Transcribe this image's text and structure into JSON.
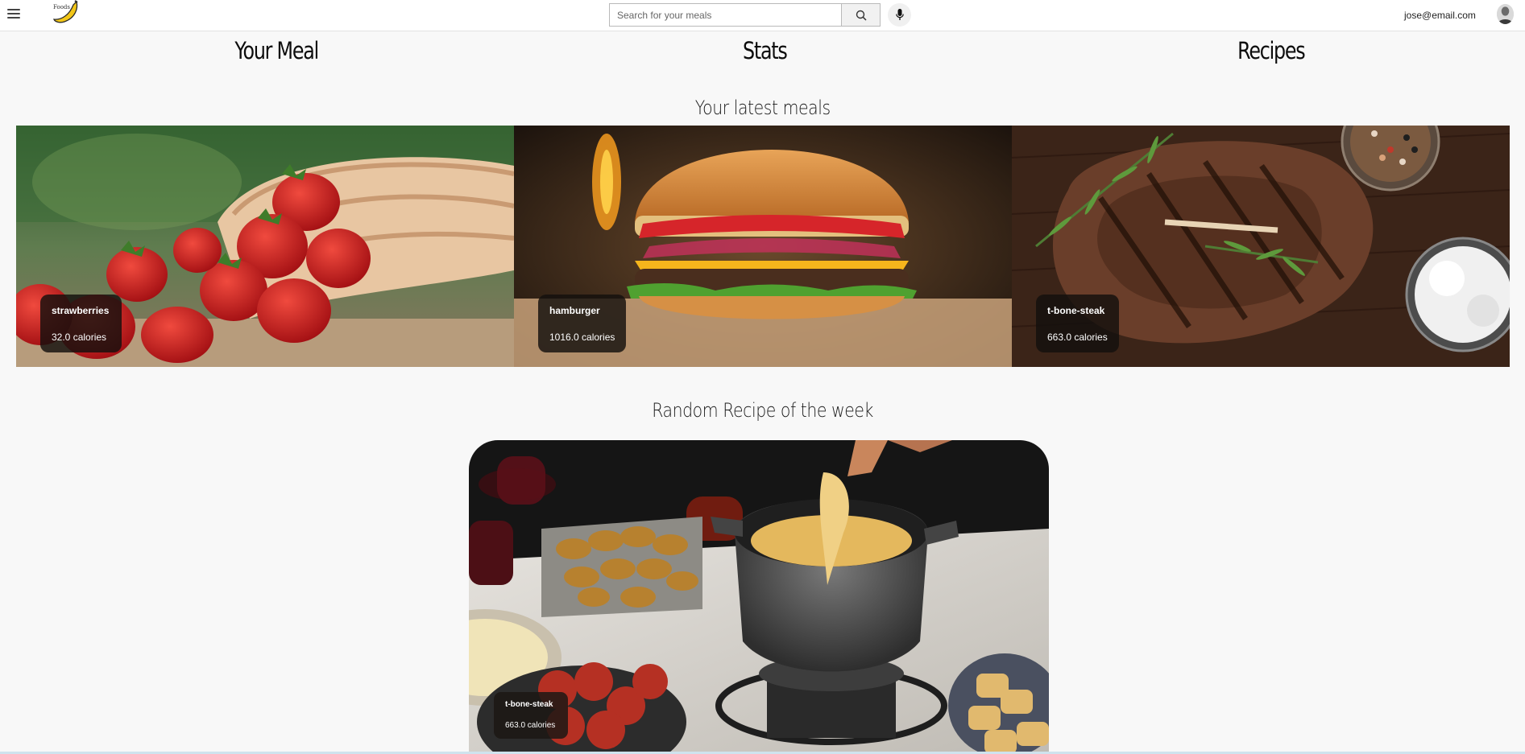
{
  "header": {
    "logo_text": "Foods",
    "search_placeholder": "Search for your meals",
    "user_email": "jose@email.com",
    "icons": [
      "hamburger-menu-icon",
      "banana-logo-icon",
      "search-icon",
      "microphone-icon",
      "user-avatar"
    ]
  },
  "nav": {
    "your_meal": "Your Meal",
    "stats": "Stats",
    "recipes": "Recipes"
  },
  "latest_meals": {
    "title": "Your latest meals",
    "items": [
      {
        "name": "strawberries",
        "calories": "32.0 calories"
      },
      {
        "name": "hamburger",
        "calories": "1016.0 calories"
      },
      {
        "name": "t-bone-steak",
        "calories": "663.0 calories"
      }
    ]
  },
  "random_recipe": {
    "title": "Random Recipe of the week",
    "name": "t-bone-steak",
    "calories": "663.0 calories"
  }
}
